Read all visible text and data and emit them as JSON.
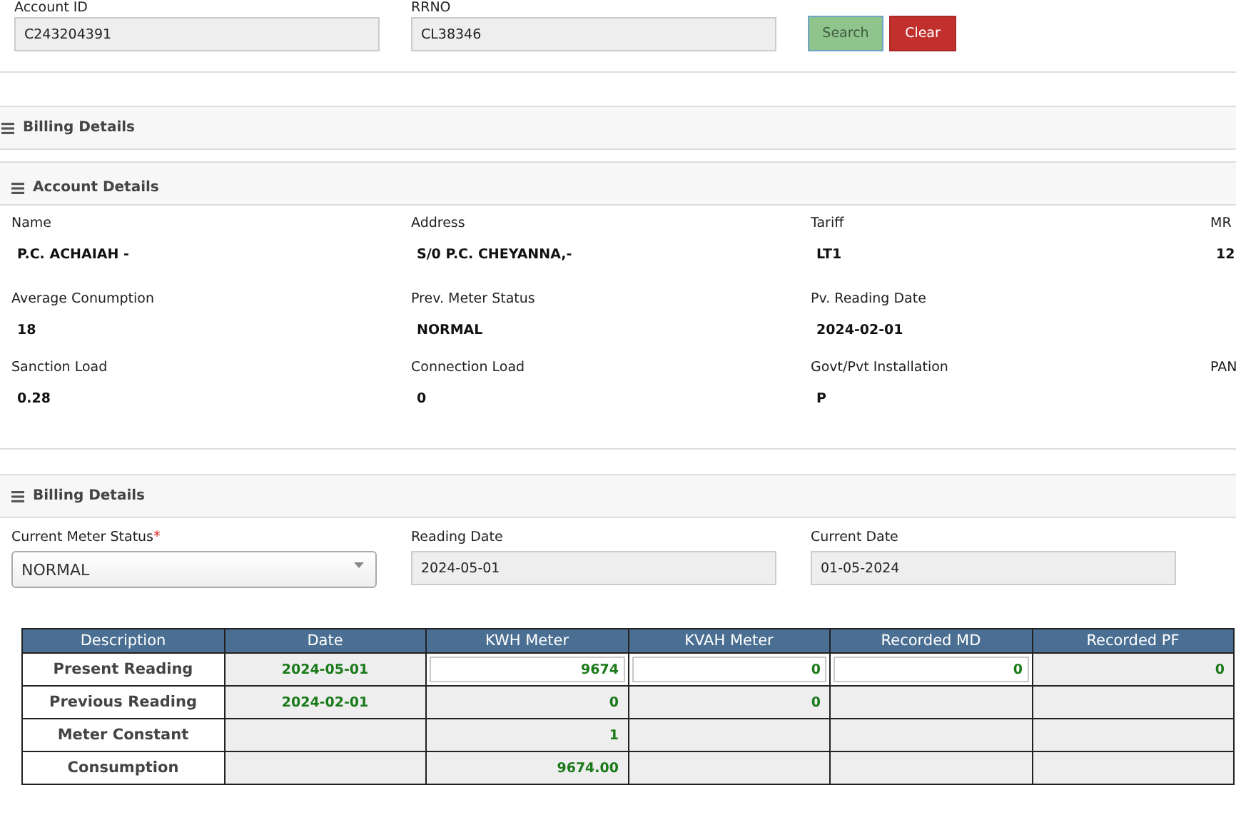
{
  "search_bar": {
    "fields": [
      {
        "label": "Account ID",
        "value": "C243204391"
      },
      {
        "label": "RRNO",
        "value": "CL38346"
      }
    ],
    "buttons": [
      {
        "label": "Search",
        "kind": "primary"
      },
      {
        "label": "Clear",
        "kind": "danger"
      }
    ]
  },
  "sections": [
    {
      "title": "Billing Details",
      "kind": "header"
    },
    {
      "title": "Account Details",
      "kind": "details",
      "rows": [
        [
          {
            "label": "Name",
            "value": "P.C. ACHAIAH -"
          },
          {
            "label": "Address",
            "value": "S/0 P.C. CHEYANNA,-"
          },
          {
            "label": "Tariff",
            "value": "LT1"
          },
          {
            "label": "MR",
            "value": "12"
          }
        ],
        [
          {
            "label": "Average Conumption",
            "value": "18"
          },
          {
            "label": "Prev. Meter Status",
            "value": "NORMAL"
          },
          {
            "label": "Pv. Reading Date",
            "value": "2024-02-01"
          }
        ],
        [
          {
            "label": "Sanction Load",
            "value": "0.28"
          },
          {
            "label": "Connection Load",
            "value": "0"
          },
          {
            "label": "Govt/Pvt Installation",
            "value": "P"
          },
          {
            "label": "PAN"
          }
        ]
      ]
    },
    {
      "title": "Billing Details",
      "kind": "form",
      "fields": [
        {
          "label": "Current Meter Status",
          "required_mark": "*",
          "kind": "select",
          "value": "NORMAL"
        },
        {
          "label": "Reading Date",
          "kind": "text",
          "value": "2024-05-01"
        },
        {
          "label": "Current Date",
          "kind": "text",
          "value": "01-05-2024"
        }
      ]
    }
  ],
  "table": {
    "columns": [
      "Description",
      "Date",
      "KWH Meter",
      "KVAH Meter",
      "Recorded MD",
      "Recorded PF"
    ],
    "rows": [
      {
        "cells": [
          {
            "kind": "label",
            "value": "Present Reading"
          },
          {
            "kind": "date",
            "value": "2024-05-01",
            "editable": false
          },
          {
            "kind": "number",
            "value": "9674",
            "editable": true
          },
          {
            "kind": "number",
            "value": "0",
            "editable": true
          },
          {
            "kind": "number",
            "value": "0",
            "editable": true
          },
          {
            "kind": "number",
            "value": "0",
            "editable": false
          }
        ]
      },
      {
        "cells": [
          {
            "kind": "label",
            "value": "Previous Reading"
          },
          {
            "kind": "date",
            "value": "2024-02-01",
            "editable": false
          },
          {
            "kind": "number",
            "value": "0",
            "editable": false
          },
          {
            "kind": "number",
            "value": "0",
            "editable": false
          },
          {
            "kind": "number",
            "editable": false
          },
          {
            "kind": "number",
            "editable": false
          }
        ]
      },
      {
        "cells": [
          {
            "kind": "label",
            "value": "Meter Constant"
          },
          {
            "kind": "date",
            "editable": false
          },
          {
            "kind": "number",
            "value": "1",
            "editable": false
          },
          {
            "kind": "number",
            "editable": false
          },
          {
            "kind": "number",
            "editable": false
          },
          {
            "kind": "number",
            "editable": false
          }
        ]
      },
      {
        "cells": [
          {
            "kind": "label",
            "value": "Consumption"
          },
          {
            "kind": "date",
            "editable": false
          },
          {
            "kind": "number",
            "value": "9674.00",
            "editable": false
          },
          {
            "kind": "number",
            "editable": false
          },
          {
            "kind": "number",
            "editable": false
          },
          {
            "kind": "number",
            "editable": false
          }
        ]
      }
    ]
  }
}
